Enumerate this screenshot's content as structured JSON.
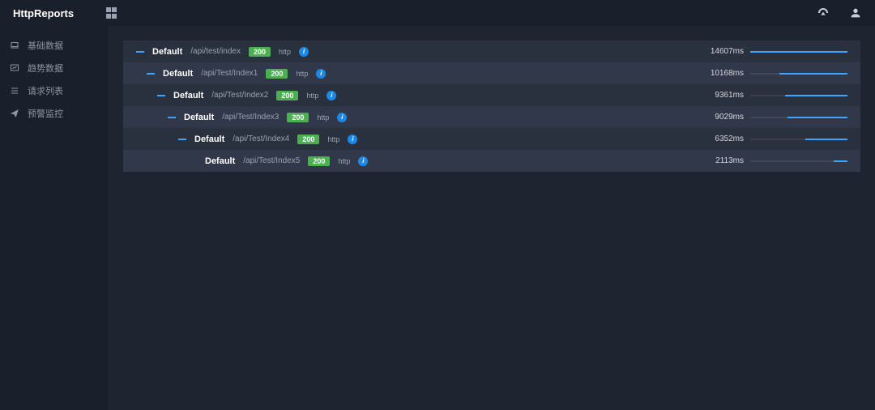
{
  "header": {
    "title": "HttpReports"
  },
  "sidebar": {
    "items": [
      {
        "label": "基础数据"
      },
      {
        "label": "趋势数据"
      },
      {
        "label": "请求列表"
      },
      {
        "label": "预警监控"
      }
    ]
  },
  "trace": {
    "max_ms": 14607,
    "rows": [
      {
        "indent": 0,
        "collapsible": true,
        "service": "Default",
        "route": "/api/test/index",
        "status": "200",
        "proto": "http",
        "duration_ms": 14607,
        "duration_label": "14607ms"
      },
      {
        "indent": 1,
        "collapsible": true,
        "service": "Default",
        "route": "/api/Test/Index1",
        "status": "200",
        "proto": "http",
        "duration_ms": 10168,
        "duration_label": "10168ms"
      },
      {
        "indent": 2,
        "collapsible": true,
        "service": "Default",
        "route": "/api/Test/Index2",
        "status": "200",
        "proto": "http",
        "duration_ms": 9361,
        "duration_label": "9361ms"
      },
      {
        "indent": 3,
        "collapsible": true,
        "service": "Default",
        "route": "/api/Test/Index3",
        "status": "200",
        "proto": "http",
        "duration_ms": 9029,
        "duration_label": "9029ms"
      },
      {
        "indent": 4,
        "collapsible": true,
        "service": "Default",
        "route": "/api/Test/Index4",
        "status": "200",
        "proto": "http",
        "duration_ms": 6352,
        "duration_label": "6352ms"
      },
      {
        "indent": 5,
        "collapsible": false,
        "service": "Default",
        "route": "/api/Test/Index5",
        "status": "200",
        "proto": "http",
        "duration_ms": 2113,
        "duration_label": "2113ms"
      }
    ]
  }
}
